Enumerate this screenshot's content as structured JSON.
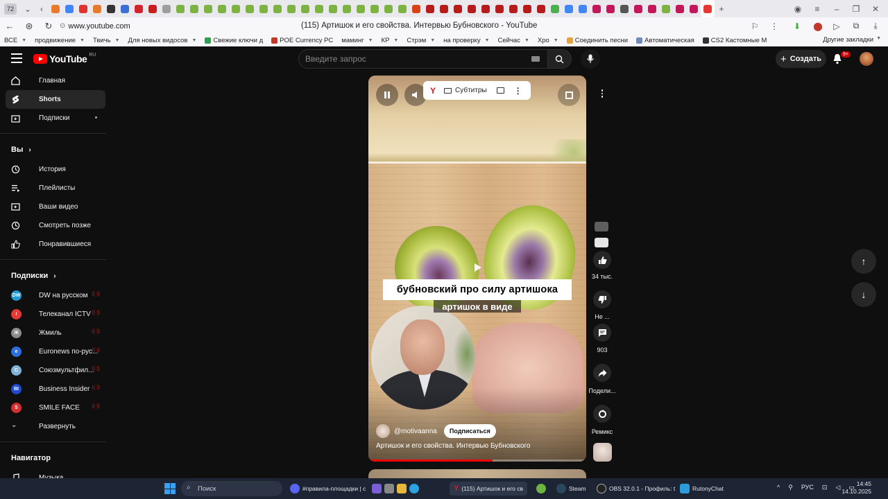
{
  "browser": {
    "tab_count": "72",
    "url": "www.youtube.com",
    "page_title": "(115) Артишок и его свойства. Интервью Бубновского - YouTube",
    "bookmarks": [
      {
        "label": "ВСЕ",
        "color": "#ffffff",
        "dropdown": true
      },
      {
        "label": "продвижение",
        "color": "#ffffff",
        "dropdown": true
      },
      {
        "label": "Твичь",
        "color": "#ffffff",
        "dropdown": true
      },
      {
        "label": "Для новых видосов",
        "color": "#ffffff",
        "dropdown": true
      },
      {
        "label": "Свежие ключи д",
        "color": "#2e9e4f",
        "dropdown": false
      },
      {
        "label": "POE Currency PC",
        "color": "#c0392b",
        "dropdown": false
      },
      {
        "label": "маминг",
        "color": "#ffffff",
        "dropdown": true
      },
      {
        "label": "КР",
        "color": "#ffffff",
        "dropdown": true
      },
      {
        "label": "Стрэм",
        "color": "#ffffff",
        "dropdown": true
      },
      {
        "label": "на проверку",
        "color": "#ffffff",
        "dropdown": true
      },
      {
        "label": "Сейчас",
        "color": "#ffffff",
        "dropdown": true
      },
      {
        "label": "Хро",
        "color": "#ffffff",
        "dropdown": true
      },
      {
        "label": "Соединить песни",
        "color": "#e6a23c",
        "dropdown": false
      },
      {
        "label": "Автоматическая",
        "color": "#6c8ebf",
        "dropdown": false
      },
      {
        "label": "CS2 Кастомные М",
        "color": "#333333",
        "dropdown": false
      }
    ],
    "other_bookmarks": "Другие закладки"
  },
  "youtube": {
    "logo_text": "YouTube",
    "logo_region": "RU",
    "search_placeholder": "Введите запрос",
    "create_label": "Создать",
    "notif_badge": "9+",
    "sidebar": {
      "main": [
        {
          "label": "Главная",
          "icon": "home-icon",
          "active": false
        },
        {
          "label": "Shorts",
          "icon": "shorts-icon",
          "active": true
        },
        {
          "label": "Подписки",
          "icon": "subscriptions-icon",
          "active": false,
          "dot": true
        }
      ],
      "you_header": "Вы",
      "you": [
        {
          "label": "История",
          "icon": "history-icon"
        },
        {
          "label": "Плейлисты",
          "icon": "playlist-icon"
        },
        {
          "label": "Ваши видео",
          "icon": "your-videos-icon"
        },
        {
          "label": "Смотреть позже",
          "icon": "watch-later-icon"
        },
        {
          "label": "Понравившиеся",
          "icon": "like-icon"
        }
      ],
      "subs_header": "Подписки",
      "subs": [
        {
          "label": "DW на русском",
          "color": "#1f9ad6",
          "mark": "DW"
        },
        {
          "label": "Телеканал ICTV",
          "color": "#e53935",
          "mark": "I"
        },
        {
          "label": "Жмиль",
          "color": "#8c8c8c",
          "mark": "Ж"
        },
        {
          "label": "Euronews по-рус...",
          "color": "#2a6fdb",
          "mark": "e"
        },
        {
          "label": "Союзмультфил...",
          "color": "#7fb2d6",
          "mark": "С"
        },
        {
          "label": "Business Insider",
          "color": "#1e4bd2",
          "mark": "BI"
        },
        {
          "label": "SMILE FACE",
          "color": "#d62f2f",
          "mark": "S"
        }
      ],
      "expand": "Развернуть",
      "nav_header": "Навигатор",
      "nav": [
        {
          "label": "Музыка",
          "icon": "music-icon"
        }
      ]
    },
    "player": {
      "subtitles_label": "Субтитры",
      "caption_main": "бубновский про силу артишока",
      "caption_sub": "артишок в виде",
      "channel": "@motivaanna",
      "subscribe": "Подписаться",
      "title": "Артишок и его свойства. Интервью Бубновского",
      "progress": 0.57
    },
    "actions": {
      "likes": "34 тыс.",
      "dislike": "Не ...",
      "comments": "903",
      "share": "Подели...",
      "remix": "Ремикс"
    }
  },
  "taskbar": {
    "search": "Поиск",
    "apps": [
      {
        "label": "#правила-площадки | с",
        "color": "#5865f2"
      },
      {
        "label": "(115) Артишок и его св",
        "color": "#e0181e",
        "active": true
      },
      {
        "label": "Steam",
        "color": "#2a475e"
      },
      {
        "label": "OBS 32.0.1 - Профиль: t",
        "color": "#333333"
      },
      {
        "label": "RutonyChat",
        "color": "#2d9cdb"
      }
    ],
    "lang": "РУС",
    "time": "14:45",
    "date": "14.10.2025"
  }
}
